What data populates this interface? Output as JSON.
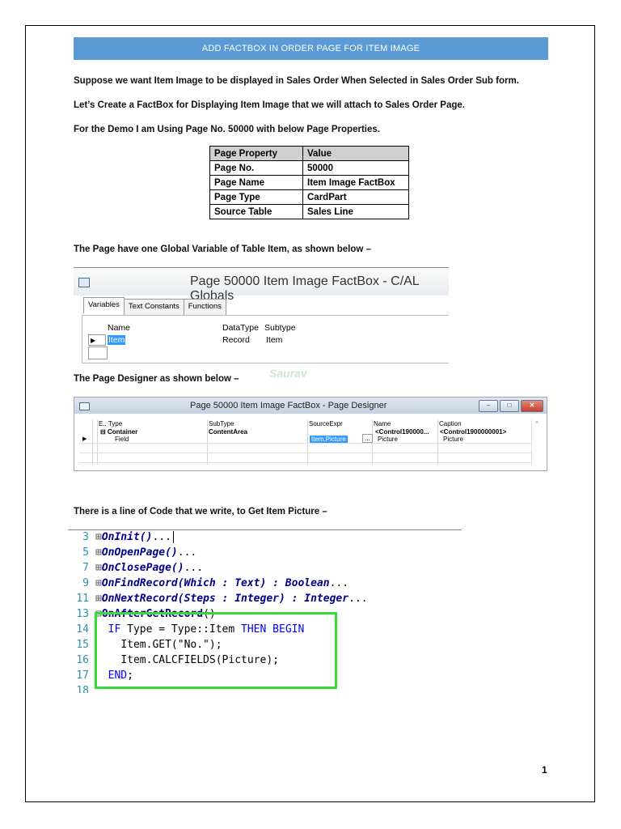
{
  "banner": "ADD FACTBOX IN ORDER PAGE FOR ITEM IMAGE",
  "paragraphs": [
    "Suppose we want Item Image to be displayed in Sales Order When Selected in Sales Order Sub form.",
    "Let’s Create a FactBox for Displaying Item Image that we will attach to Sales Order Page.",
    "For the Demo I am Using Page No. 50000 with below Page Properties."
  ],
  "prop_table": {
    "headers": [
      "Page Property",
      "Value"
    ],
    "rows": [
      [
        "Page No.",
        "50000"
      ],
      [
        "Page Name",
        "Item Image FactBox"
      ],
      [
        "Page Type",
        "CardPart"
      ],
      [
        "Source Table",
        "Sales Line"
      ]
    ]
  },
  "globals_intro": "The Page have one Global Variable of Table Item, as shown below –",
  "globals_window": {
    "title": "Page 50000 Item Image FactBox - C/AL Globals",
    "tabs": [
      "Variables",
      "Text Constants",
      "Functions"
    ],
    "columns": [
      "Name",
      "DataType",
      "Subtype"
    ],
    "row": [
      "Item",
      "Record",
      "Item"
    ]
  },
  "designer_intro": "The Page Designer as shown below –",
  "watermark": "Saurav",
  "designer_window": {
    "title": "Page 50000 Item Image FactBox - Page Designer",
    "buttons": [
      "–",
      "□",
      "✕"
    ],
    "columns": [
      "E.. Type",
      "SubType",
      "SourceExpr",
      "Name",
      "Caption"
    ],
    "row1": [
      "⊟ Container",
      "ContentArea",
      "",
      "<Control190000...",
      "<Control1900000001>"
    ],
    "row2": [
      "Field",
      "",
      "Item.Picture",
      "Picture",
      "Picture"
    ],
    "ellipsis": "..."
  },
  "code_intro": "There is a line of Code that we write, to Get Item Picture –",
  "code_lines": [
    {
      "num": "3",
      "fold": "⊞",
      "trig": "OnInit()",
      "rest": "..."
    },
    {
      "num": "5",
      "fold": "⊞",
      "trig": "OnOpenPage()",
      "rest": "..."
    },
    {
      "num": "7",
      "fold": "⊞",
      "trig": "OnClosePage()",
      "rest": "..."
    },
    {
      "num": "9",
      "fold": "⊞",
      "trig": "OnFindRecord(Which : Text) : Boolean",
      "rest": "..."
    },
    {
      "num": "11",
      "fold": "⊞",
      "trig": "OnNextRecord(Steps : Integer) : Integer",
      "rest": "..."
    },
    {
      "num": "13",
      "fold": "⊟",
      "trig": "OnAfterGetRecord",
      "rest": "()"
    }
  ],
  "code_body": {
    "l14": {
      "num": "14",
      "kw1": "IF",
      "mid": " Type = Type::Item ",
      "kw2": "THEN BEGIN"
    },
    "l15": {
      "num": "15",
      "text": "Item.GET(\"No.\");"
    },
    "l16": {
      "num": "16",
      "text": "Item.CALCFIELDS(Picture);"
    },
    "l17": {
      "num": "17",
      "kw": "END",
      "tail": ";"
    },
    "l18": {
      "num": "18"
    }
  },
  "page_number": "1"
}
